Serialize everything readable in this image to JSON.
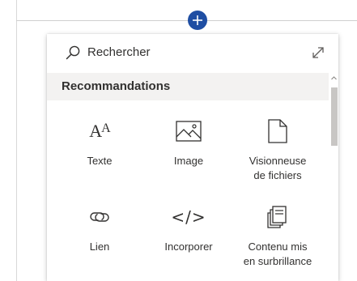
{
  "search": {
    "placeholder": "Rechercher"
  },
  "section": {
    "title": "Recommandations"
  },
  "tiles": [
    {
      "label": "Texte",
      "icon": "text-icon",
      "glyph_big": "A",
      "glyph_small": "A"
    },
    {
      "label": "Image",
      "icon": "image-icon"
    },
    {
      "label": "Visionneuse\nde fichiers",
      "icon": "file-viewer-icon"
    },
    {
      "label": "Lien",
      "icon": "link-icon"
    },
    {
      "label": "Incorporer",
      "icon": "embed-icon",
      "glyph": "</>"
    },
    {
      "label": "Contenu mis\nen surbrillance",
      "icon": "highlighted-content-icon"
    }
  ],
  "colors": {
    "accent": "#1f4ea3",
    "header_bg": "#f3f2f1",
    "text": "#323130",
    "scroll_thumb": "#c8c6c4"
  }
}
